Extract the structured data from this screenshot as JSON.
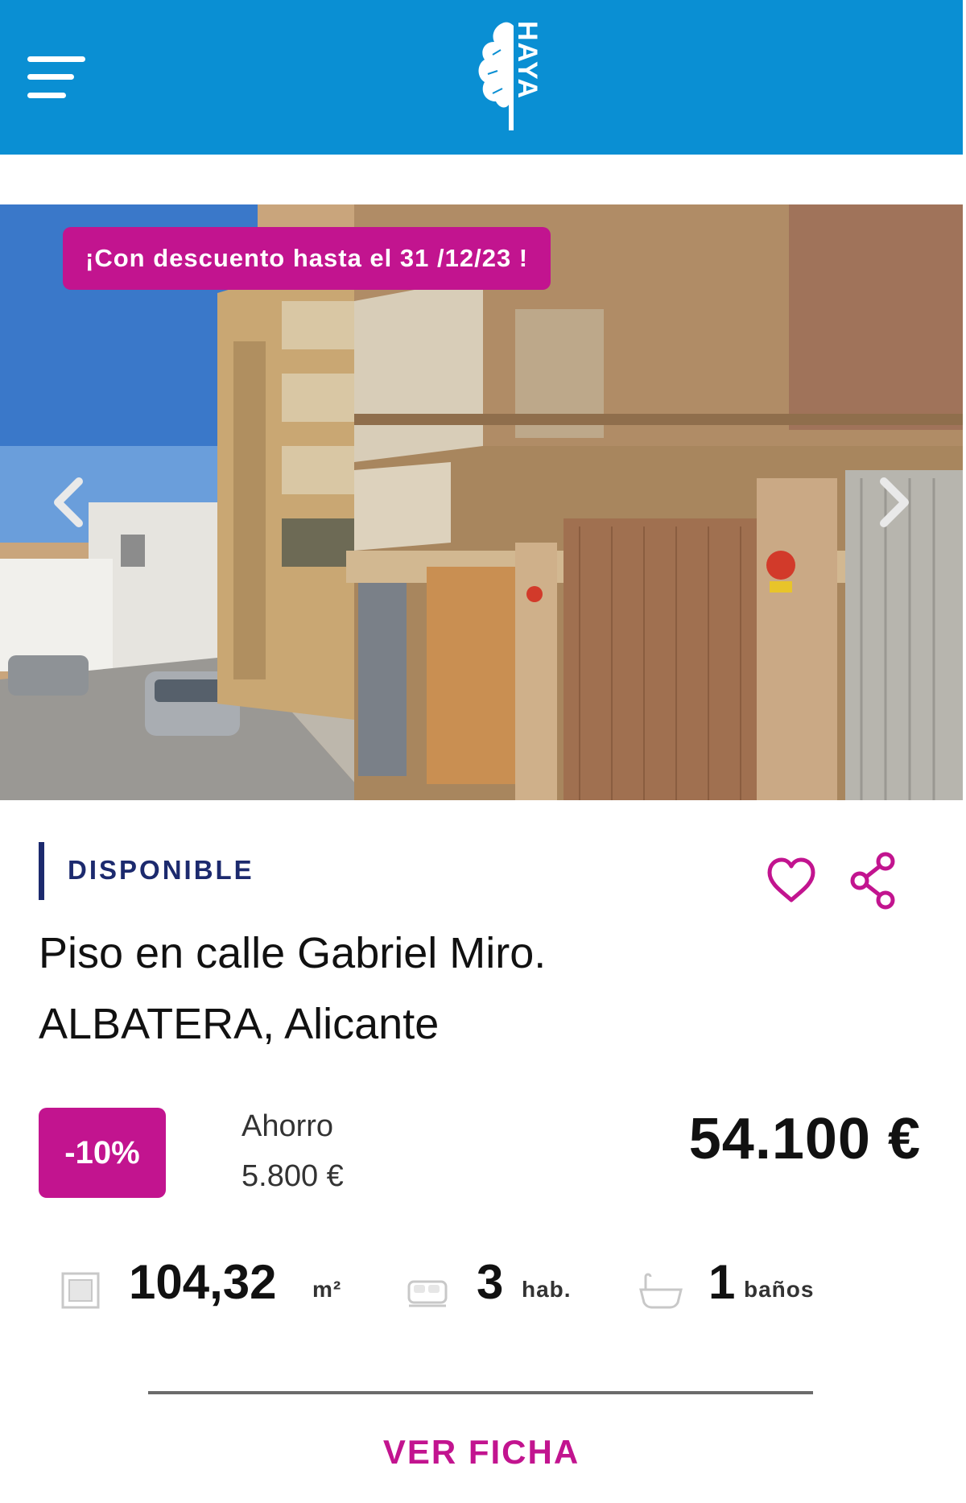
{
  "header": {
    "menu_icon": "hamburger-menu-icon",
    "logo_text": "HAYA",
    "logo_icon": "tree-logo-icon"
  },
  "listing": {
    "promo_badge": "¡Con descuento hasta el 31 /12/23 !",
    "photo_alt": "Fachada del edificio con garajes",
    "status": "DISPONIBLE",
    "title_line1": "Piso en calle Gabriel Miro.",
    "title_line2": "ALBATERA, Alicante",
    "discount": "-10%",
    "savings_label": "Ahorro",
    "savings_value": "5.800 €",
    "price": "54.100 €",
    "features": {
      "area_value": "104,32",
      "area_unit": "m²",
      "rooms_value": "3",
      "rooms_unit": "hab.",
      "baths_value": "1",
      "baths_unit": "baños"
    },
    "cta_label": "VER FICHA"
  },
  "colors": {
    "header_blue": "#0a8fd3",
    "accent_magenta": "#c2148f",
    "status_navy": "#1c2a6e"
  }
}
